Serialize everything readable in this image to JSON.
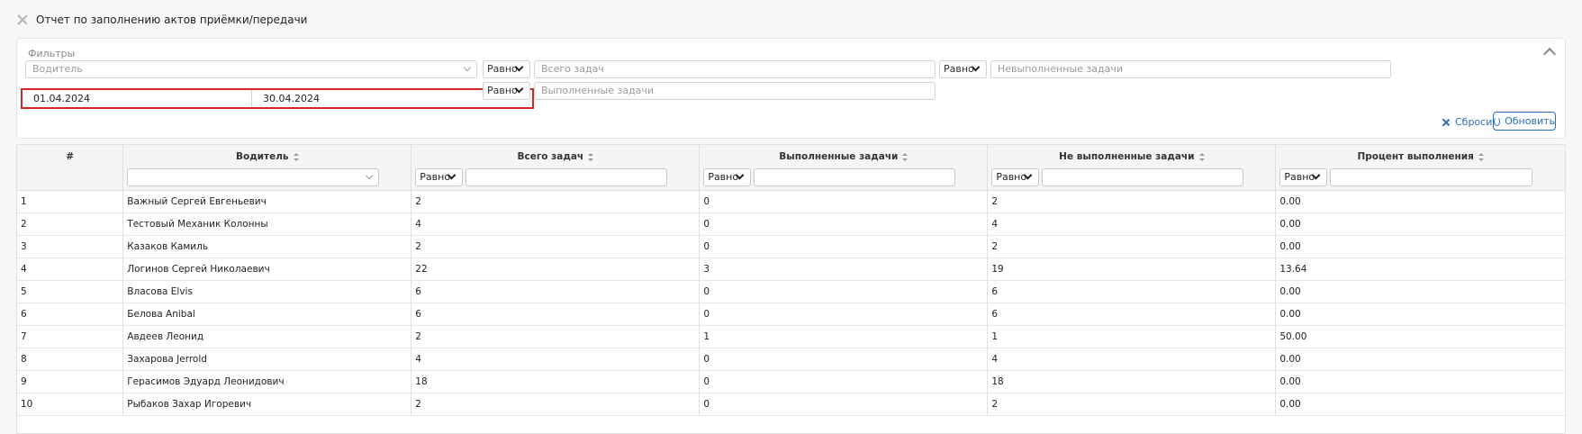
{
  "header": {
    "title": "Отчет по заполнению актов приёмки/передачи"
  },
  "filters": {
    "title": "Фильтры",
    "driver_placeholder": "Водитель",
    "total_op": "Равно",
    "total_placeholder": "Всего задач",
    "unfinished_op": "Равно",
    "unfinished_placeholder": "Невыполненные задачи",
    "date_from": "01.04.2024",
    "date_to": "30.04.2024",
    "done_op": "Равно",
    "done_placeholder": "Выполненные задачи",
    "reset_label": "Сбросить",
    "refresh_label": "Обновить"
  },
  "table": {
    "columns": [
      "#",
      "Водитель",
      "Всего задач",
      "Выполненные задачи",
      "Не выполненные задачи",
      "Процент выполнения"
    ],
    "filter_op": "Равно",
    "rows": [
      [
        "1",
        "Важный Сергей Евгеньевич",
        "2",
        "0",
        "2",
        "0.00"
      ],
      [
        "2",
        "Тестовый Механик Колонны",
        "4",
        "0",
        "4",
        "0.00"
      ],
      [
        "3",
        "Казаков Камиль",
        "2",
        "0",
        "2",
        "0.00"
      ],
      [
        "4",
        "Логинов Сергей Николаевич",
        "22",
        "3",
        "19",
        "13.64"
      ],
      [
        "5",
        "Власова Elvis",
        "6",
        "0",
        "6",
        "0.00"
      ],
      [
        "6",
        "Белова Anibal",
        "6",
        "0",
        "6",
        "0.00"
      ],
      [
        "7",
        "Авдеев Леонид",
        "2",
        "1",
        "1",
        "50.00"
      ],
      [
        "8",
        "Захарова Jerrold",
        "4",
        "0",
        "4",
        "0.00"
      ],
      [
        "9",
        "Герасимов Эдуард Леонидович",
        "18",
        "0",
        "18",
        "0.00"
      ],
      [
        "10",
        "Рыбаков Захар Игоревич",
        "2",
        "0",
        "2",
        "0.00"
      ]
    ]
  }
}
